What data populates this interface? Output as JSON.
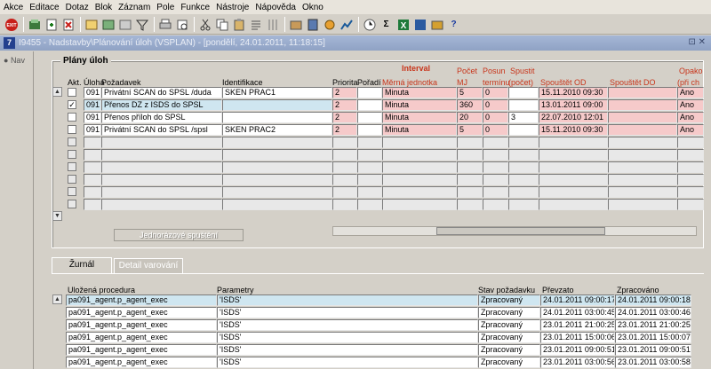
{
  "menu": [
    "Akce",
    "Editace",
    "Dotaz",
    "Blok",
    "Záznam",
    "Pole",
    "Funkce",
    "Nástroje",
    "Nápověda",
    "Okno"
  ],
  "window": {
    "title": "I9455 - Nadstavby\\Plánování úloh (VSPLAN) - [pondělí, 24.01.2011, 11:18:15]",
    "controls": "⊡ ✕"
  },
  "nav": {
    "label": "Nav"
  },
  "plans": {
    "title": "Plány úloh",
    "headers": {
      "akt": "Akt.",
      "uloha": "Úloha",
      "pozadavek": "Požadavek",
      "identifikace": "Identifikace",
      "priorita": "Priorita",
      "poradi": "Pořadí",
      "interval": "Interval",
      "merna": "Měrná jednotka",
      "pocet": "Počet",
      "mj": "MJ",
      "posun": "Posun",
      "posun2": "termínu",
      "spustit": "Spustit",
      "spustit2": "(počet)",
      "od": "Spouštět OD",
      "do": "Spouštět DO",
      "opak": "Opako",
      "opak2": "(při ch"
    },
    "rows": [
      {
        "checked": false,
        "uloha": "091",
        "pozadavek": "Privátní SCAN do SPSL /duda",
        "ident": "SKEN PRAC1",
        "priorita": "2",
        "poradi": "",
        "jednotka": "Minuta",
        "pocet": "5",
        "posun": "0",
        "spustit": "",
        "od": "15.11.2010 09:30",
        "do": "",
        "opak": "Ano"
      },
      {
        "checked": true,
        "uloha": "091",
        "pozadavek": "Přenos DZ z ISDS do SPSL",
        "ident": "",
        "priorita": "2",
        "poradi": "",
        "jednotka": "Minuta",
        "pocet": "360",
        "posun": "0",
        "spustit": "",
        "od": "13.01.2011 09:00",
        "do": "",
        "opak": "Ano"
      },
      {
        "checked": false,
        "uloha": "091",
        "pozadavek": "Přenos příloh do SPSL",
        "ident": "",
        "priorita": "2",
        "poradi": "",
        "jednotka": "Minuta",
        "pocet": "20",
        "posun": "0",
        "spustit": "3",
        "od": "22.07.2010 12:01",
        "do": "",
        "opak": "Ano"
      },
      {
        "checked": false,
        "uloha": "091",
        "pozadavek": "Privátní SCAN do SPSL /spsl",
        "ident": "SKEN PRAC2",
        "priorita": "2",
        "poradi": "",
        "jednotka": "Minuta",
        "pocet": "5",
        "posun": "0",
        "spustit": "",
        "od": "15.11.2010 09:30",
        "do": "",
        "opak": "Ano"
      }
    ],
    "button": "Jednorázové spuštění"
  },
  "tabs": {
    "zurnal": "Žurnál",
    "detail": "Detail varování"
  },
  "journal": {
    "headers": {
      "proc": "Uložená procedura",
      "params": "Parametry",
      "stav": "Stav požadavku",
      "prevzato": "Převzato",
      "zprac": "Zpracováno"
    },
    "rows": [
      {
        "proc": "pa091_agent.p_agent_exec",
        "params": "'ISDS'",
        "stav": "Zpracovaný",
        "prevzato": "24.01.2011 09:00:17",
        "zprac": "24.01.2011 09:00:18"
      },
      {
        "proc": "pa091_agent.p_agent_exec",
        "params": "'ISDS'",
        "stav": "Zpracovaný",
        "prevzato": "24.01.2011 03:00:45",
        "zprac": "24.01.2011 03:00:46"
      },
      {
        "proc": "pa091_agent.p_agent_exec",
        "params": "'ISDS'",
        "stav": "Zpracovaný",
        "prevzato": "23.01.2011 21:00:25",
        "zprac": "23.01.2011 21:00:25"
      },
      {
        "proc": "pa091_agent.p_agent_exec",
        "params": "'ISDS'",
        "stav": "Zpracovaný",
        "prevzato": "23.01.2011 15:00:06",
        "zprac": "23.01.2011 15:00:07"
      },
      {
        "proc": "pa091_agent.p_agent_exec",
        "params": "'ISDS'",
        "stav": "Zpracovaný",
        "prevzato": "23.01.2011 09:00:51",
        "zprac": "23.01.2011 09:00:51"
      },
      {
        "proc": "pa091_agent.p_agent_exec",
        "params": "'ISDS'",
        "stav": "Zpracovaný",
        "prevzato": "23.01.2011 03:00:56",
        "zprac": "23.01.2011 03:00:58"
      }
    ]
  },
  "toolbar_icons": [
    "exit-icon",
    "save-icon",
    "new-icon",
    "delete-icon",
    "query-icon",
    "filter-icon",
    "print-icon",
    "cut-icon",
    "copy-icon",
    "paste-icon",
    "edit-icon",
    "report-icon",
    "calculator-icon",
    "sum-icon",
    "excel-icon",
    "help-icon",
    "about-icon"
  ]
}
